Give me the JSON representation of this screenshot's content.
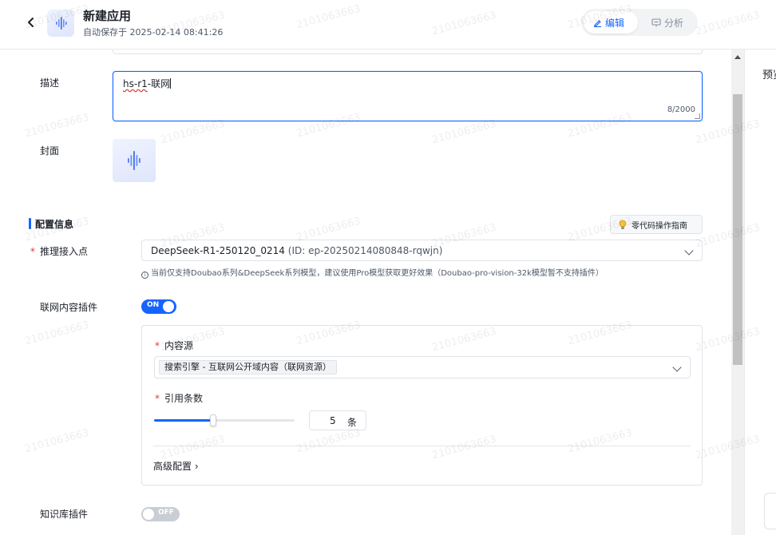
{
  "header": {
    "title": "新建应用",
    "autosave": "自动保存于 2025-02-14 08:41:26",
    "mode_edit": "编辑",
    "mode_analyze": "分析"
  },
  "form": {
    "description_label": "描述",
    "description_value": {
      "squiggle": "hs-r1",
      "rest": "-联网"
    },
    "description_count": "8/2000",
    "cover_label": "封面"
  },
  "config": {
    "section_title": "配置信息",
    "guide_button": "零代码操作指南",
    "endpoint_label": "推理接入点",
    "endpoint_value": "DeepSeek-R1-250120_0214",
    "endpoint_id": "(ID: ep-20250214080848-rqwjn)",
    "endpoint_hint": "当前仅支持Doubao系列&DeepSeek系列模型，建议使用Pro模型获取更好效果（Doubao-pro-vision-32k模型暂不支持插件）",
    "web_plugin_label": "联网内容插件",
    "web_plugin_state": "ON",
    "web_plugin_on": true
  },
  "web_plugin": {
    "source_label": "内容源",
    "source_tag": "搜索引擎 - 互联网公开域内容（联网资源）",
    "count_label": "引用条数",
    "count_value": "5",
    "count_unit": "条",
    "count_fraction": 0.42,
    "advanced_label": "高级配置"
  },
  "knowledge_plugin": {
    "label": "知识库插件",
    "state": "OFF",
    "on": false
  },
  "right_panel": {
    "label": "预览"
  },
  "watermark": "2101063663",
  "colors": {
    "primary": "#1664ff",
    "required": "#e13b3b"
  }
}
